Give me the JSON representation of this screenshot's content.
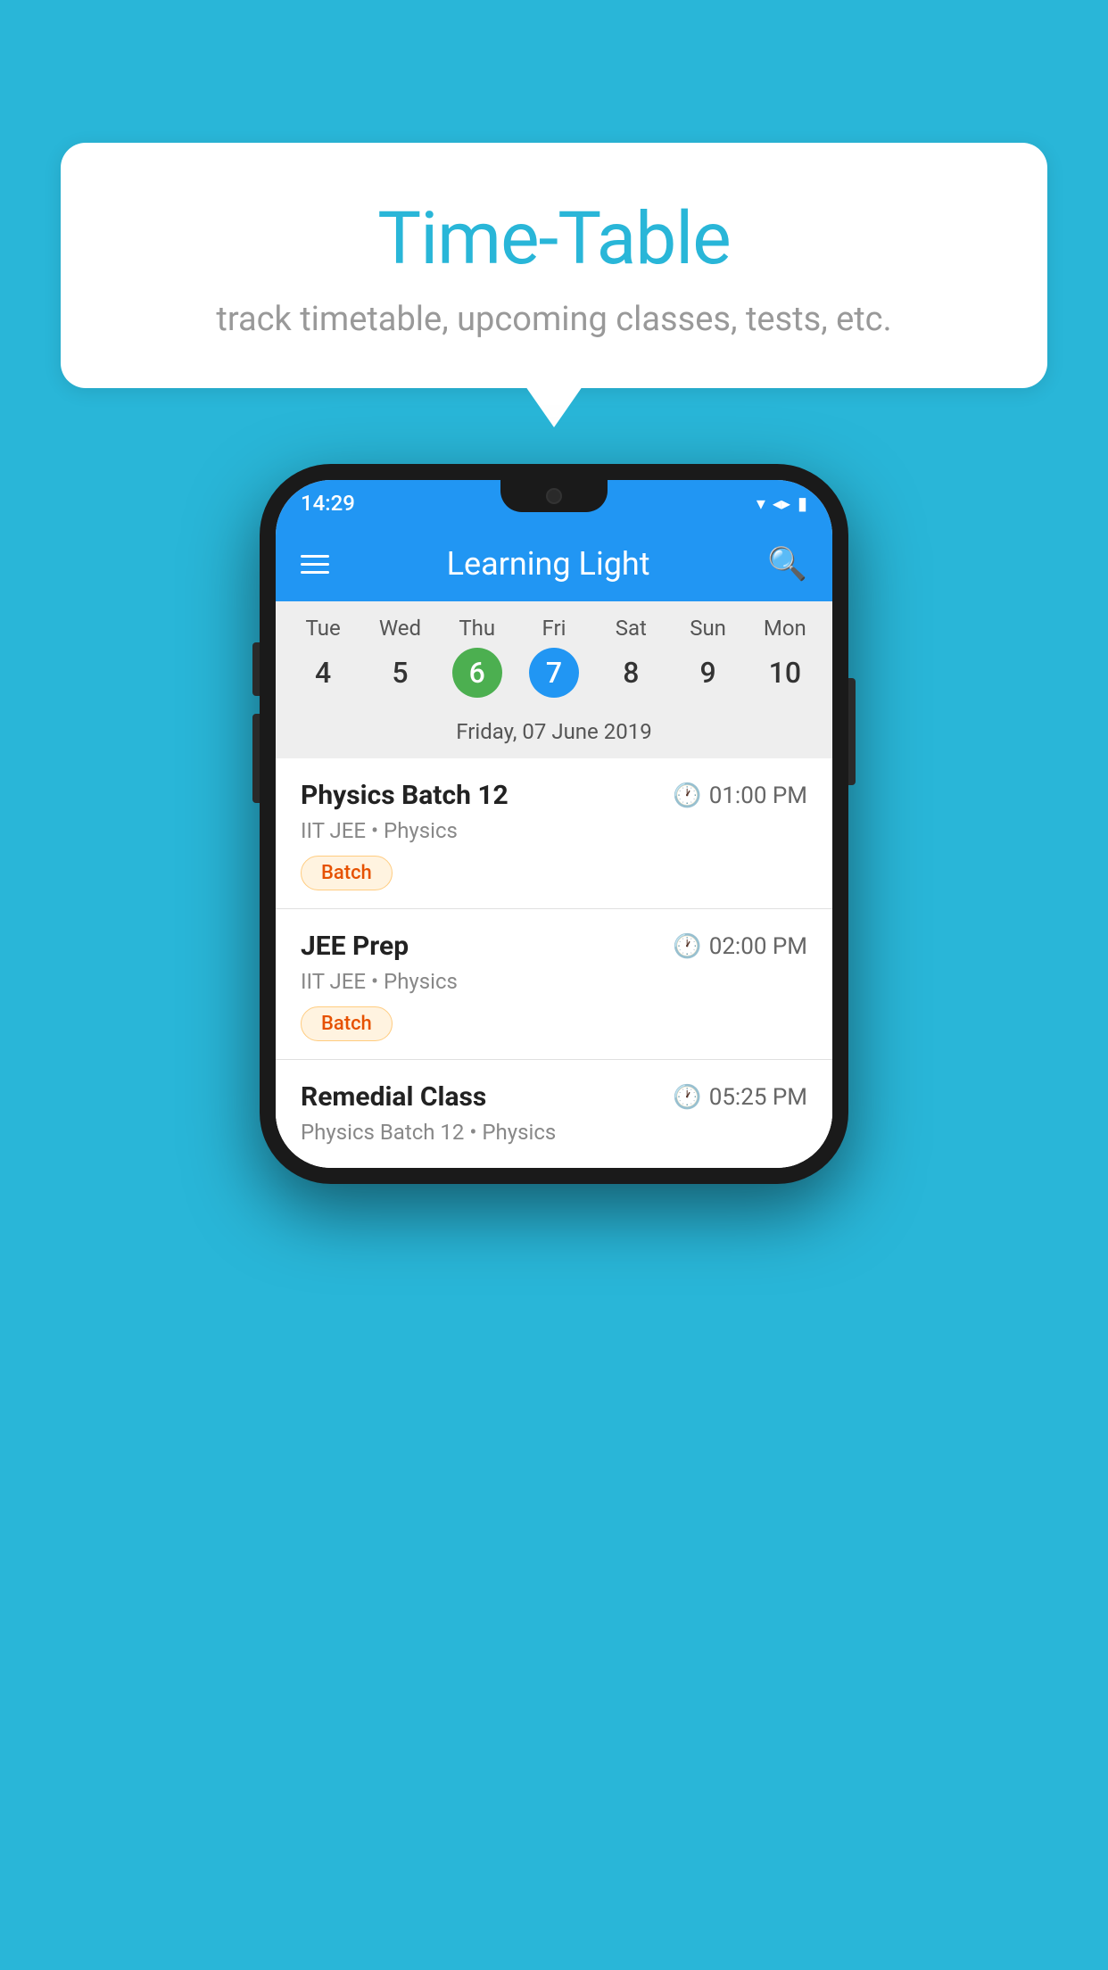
{
  "background_color": "#29B6D8",
  "bubble": {
    "title": "Time-Table",
    "subtitle": "track timetable, upcoming classes, tests, etc."
  },
  "phone": {
    "status_bar": {
      "time": "14:29",
      "icons": [
        "wifi",
        "signal",
        "battery"
      ]
    },
    "app_bar": {
      "title": "Learning Light"
    },
    "calendar": {
      "days": [
        "Tue",
        "Wed",
        "Thu",
        "Fri",
        "Sat",
        "Sun",
        "Mon"
      ],
      "dates": [
        "4",
        "5",
        "6",
        "7",
        "8",
        "9",
        "10"
      ],
      "today_index": 2,
      "selected_index": 3,
      "selected_label": "Friday, 07 June 2019"
    },
    "classes": [
      {
        "name": "Physics Batch 12",
        "time": "01:00 PM",
        "meta": "IIT JEE • Physics",
        "badge": "Batch"
      },
      {
        "name": "JEE Prep",
        "time": "02:00 PM",
        "meta": "IIT JEE • Physics",
        "badge": "Batch"
      },
      {
        "name": "Remedial Class",
        "time": "05:25 PM",
        "meta": "Physics Batch 12 • Physics",
        "badge": null
      }
    ]
  }
}
